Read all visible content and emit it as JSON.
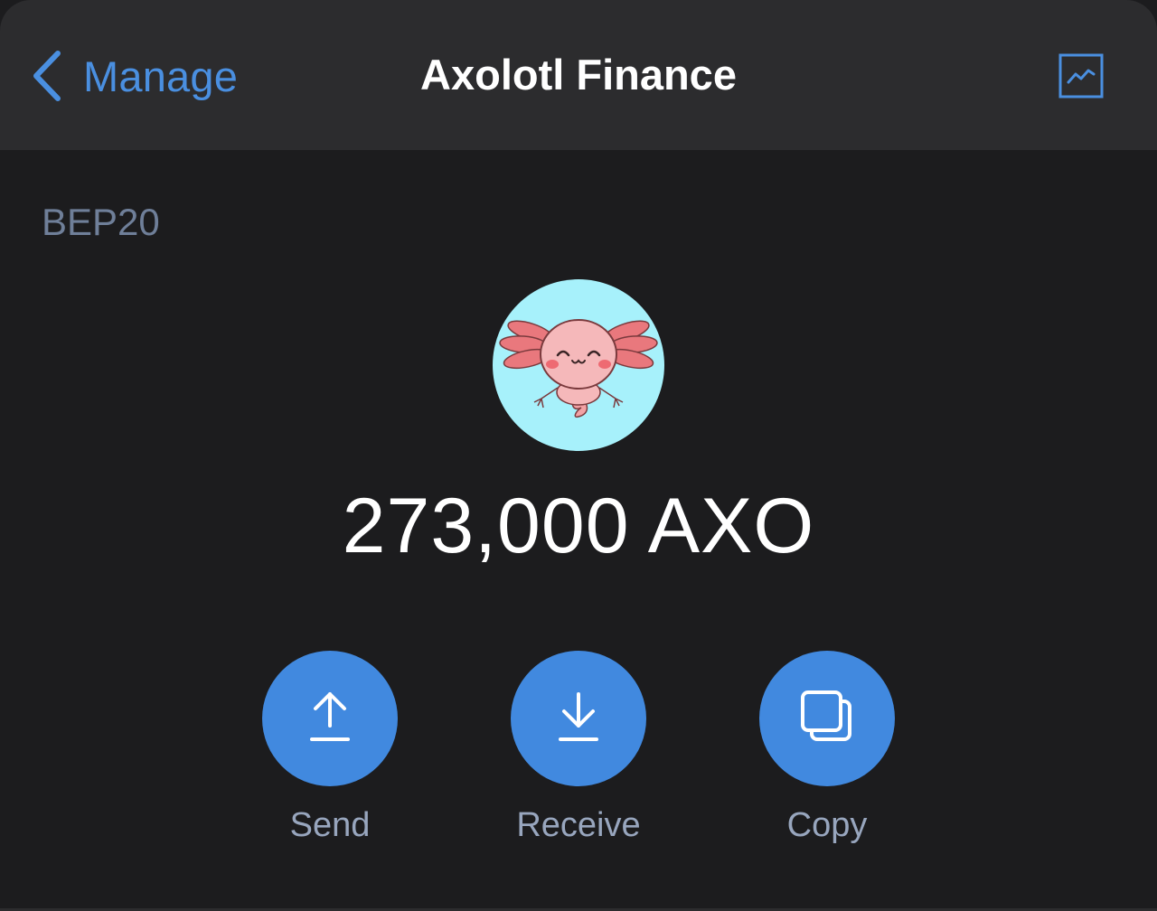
{
  "navbar": {
    "back_label": "Manage",
    "title": "Axolotl Finance",
    "back_icon": "chevron-left-icon",
    "right_icon": "chart-icon"
  },
  "token": {
    "network": "BEP20",
    "logo": "axolotl-logo",
    "balance": "273,000 AXO"
  },
  "actions": [
    {
      "label": "Send",
      "icon": "arrow-up-icon"
    },
    {
      "label": "Receive",
      "icon": "arrow-down-icon"
    },
    {
      "label": "Copy",
      "icon": "copy-icon"
    }
  ],
  "colors": {
    "background": "#1c1c1e",
    "navbar": "#2c2c2e",
    "accent": "#4189df",
    "link": "#4a8fe0",
    "muted": "#6f7f99",
    "logo_bg": "#a7f1fb"
  }
}
